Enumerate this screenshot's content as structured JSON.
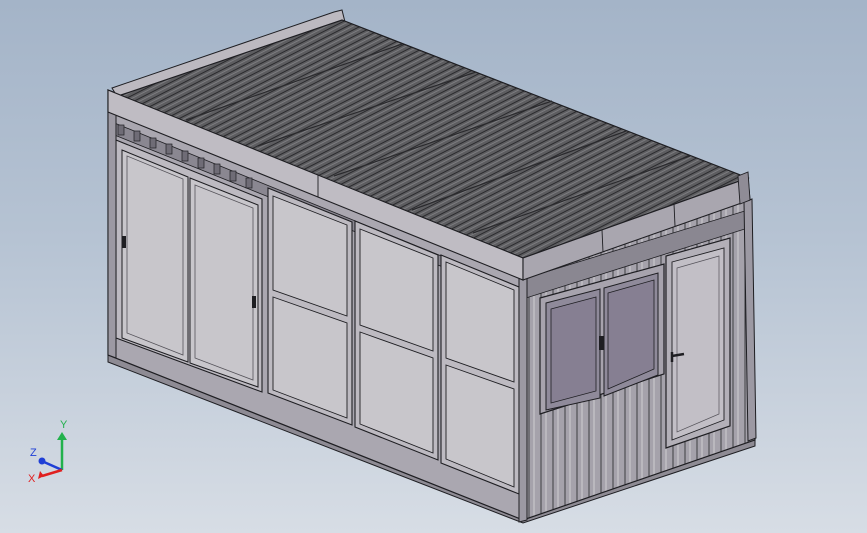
{
  "view": {
    "background_top": "#a4b4c8",
    "background_bottom": "#d7dde5"
  },
  "model": {
    "shell_color": "#a9a6af",
    "panel_color": "#c5c3c8",
    "roof_color": "#5b5b5e",
    "edge_color": "#1e1e22"
  },
  "triad": {
    "y_label": "Y",
    "z_label": "Z",
    "x_label": "X",
    "y_color": "#22b14c",
    "z_color": "#1f3fd6",
    "x_color": "#e02020"
  }
}
